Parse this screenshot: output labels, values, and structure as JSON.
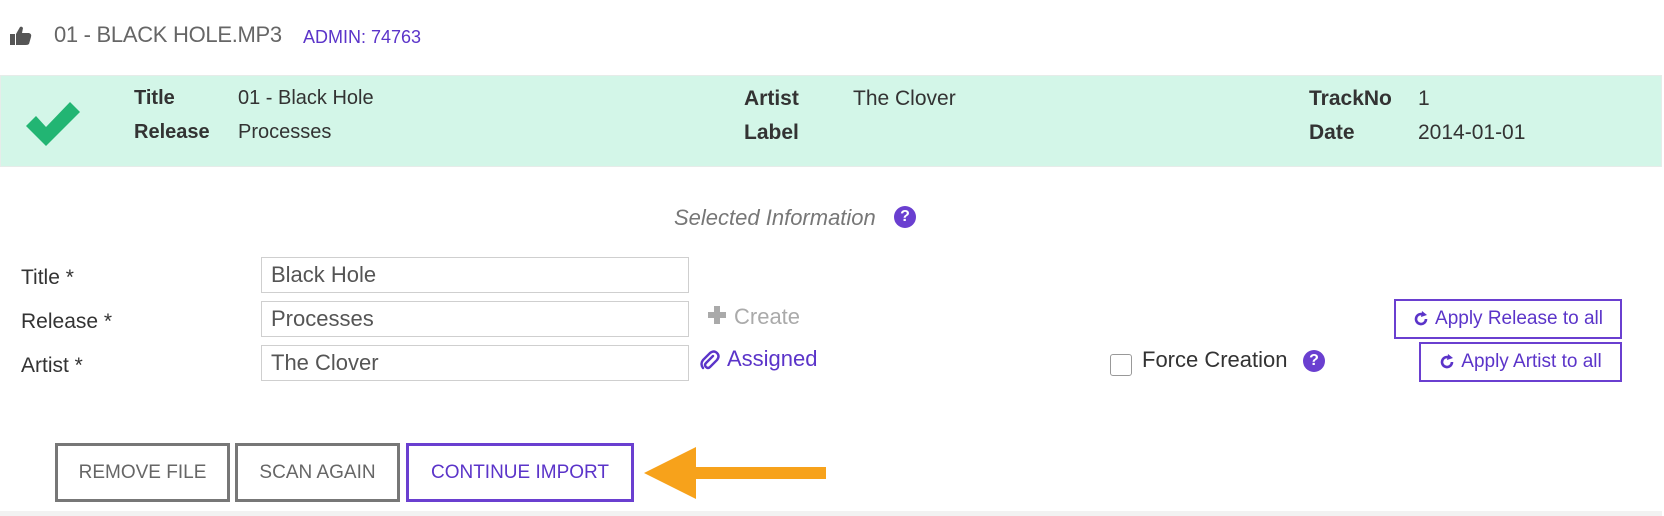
{
  "header": {
    "filename": "01 - BLACK HOLE.MP3",
    "admin_label": "ADMIN: 74763"
  },
  "match_panel": {
    "status_color": "#22b573",
    "title_label": "Title",
    "title_value": "01 - Black Hole",
    "release_label": "Release",
    "release_value": "Processes",
    "artist_label": "Artist",
    "artist_value": "The Clover",
    "label_label": "Label",
    "label_value": "",
    "trackno_label": "TrackNo",
    "trackno_value": "1",
    "date_label": "Date",
    "date_value": "2014-01-01"
  },
  "selected": {
    "heading": "Selected Information",
    "help_glyph": "?",
    "title_label": "Title *",
    "title_value": "Black Hole",
    "release_label": "Release *",
    "release_value": "Processes",
    "artist_label": "Artist *",
    "artist_value": "The Clover",
    "create_label": "Create",
    "assigned_label": "Assigned",
    "force_label": "Force Creation",
    "force_checked": false,
    "apply_release_label": "Apply Release to all",
    "apply_artist_label": "Apply Artist to all"
  },
  "actions": {
    "remove_label": "REMOVE FILE",
    "scan_label": "SCAN AGAIN",
    "continue_label": "CONTINUE IMPORT"
  },
  "colors": {
    "accent": "#6a3fd0",
    "panel_bg": "#d3f6e8",
    "arrow": "#f7a21b"
  }
}
